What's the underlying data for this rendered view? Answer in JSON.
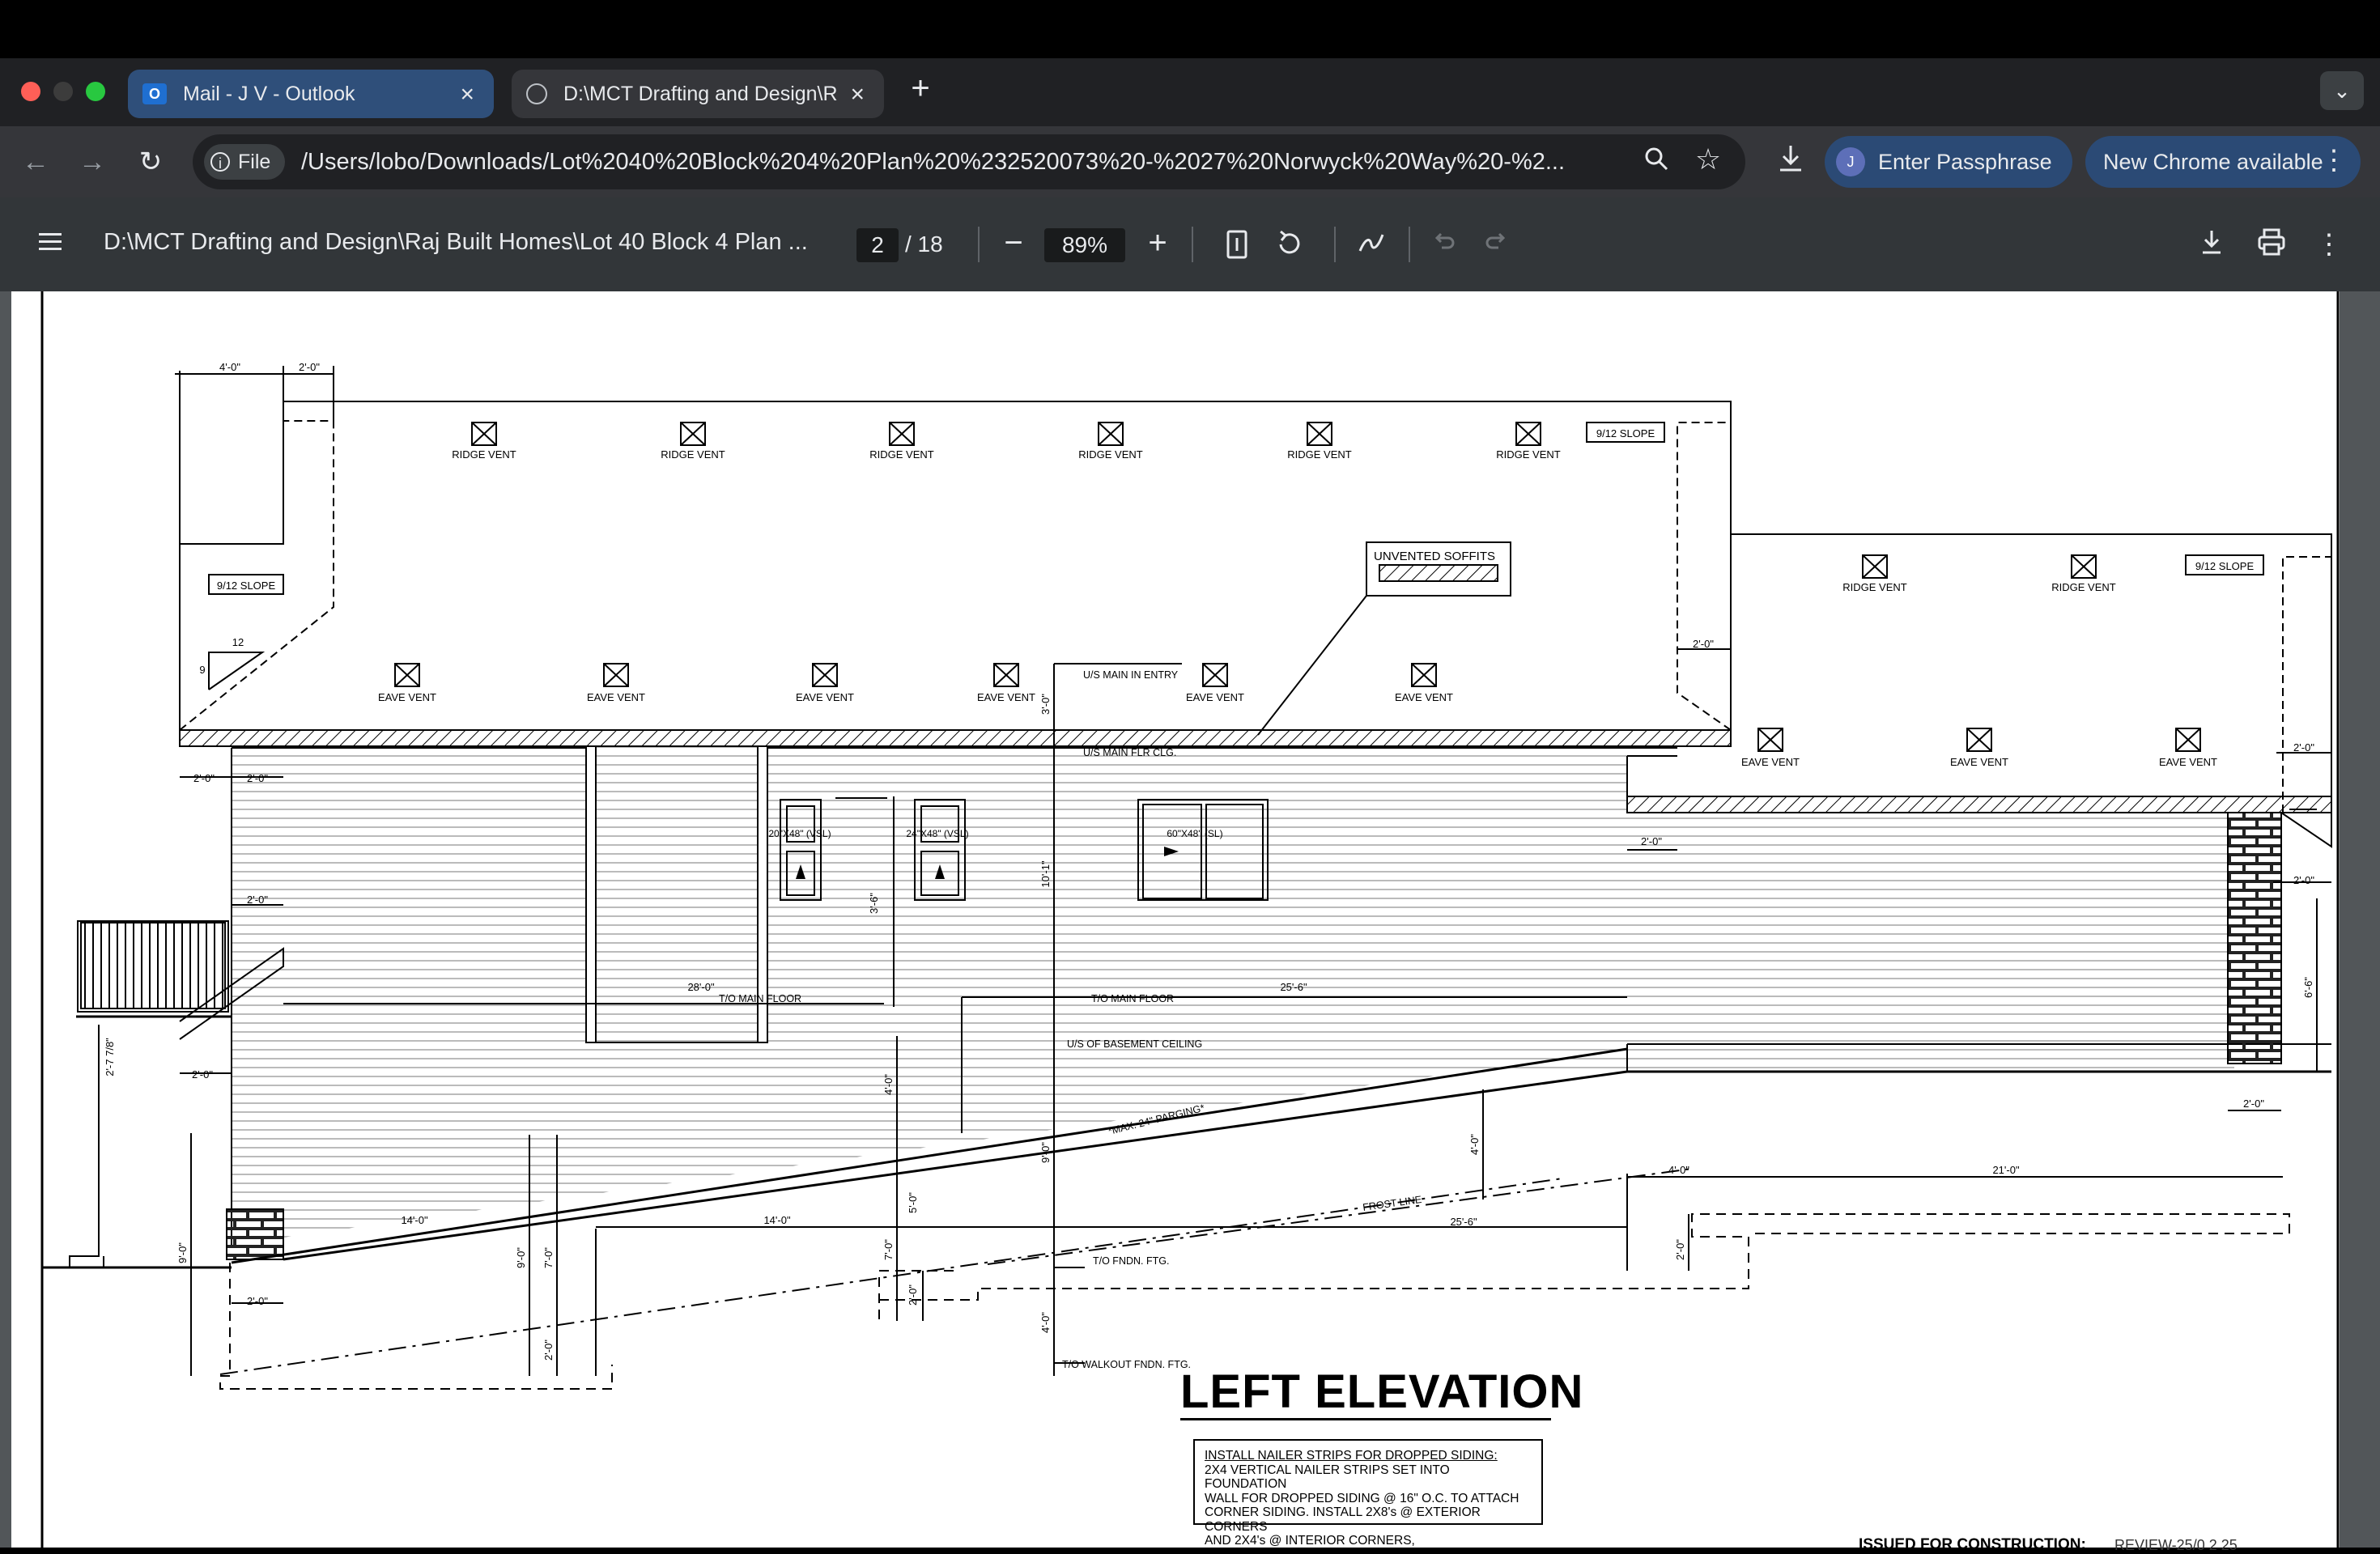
{
  "browser": {
    "tabs": [
      {
        "title": "Mail - J V - Outlook",
        "icon": "outlook-icon",
        "active": false
      },
      {
        "title": "D:\\MCT Drafting and Design\\R",
        "icon": "globe-icon",
        "active": true
      }
    ],
    "new_tab_symbol": "+",
    "url": "/Users/lobo/Downloads/Lot%2040%20Block%204%20Plan%20%232520073%20-%2027%20Norwyck%20Way%20-%2...",
    "security_chip": "File",
    "passphrase_button": "Enter Passphrase",
    "passphrase_avatar": "J",
    "update_button": "New Chrome available"
  },
  "pdf_viewer": {
    "title": "D:\\MCT Drafting and Design\\Raj Built Homes\\Lot 40 Block 4 Plan ...",
    "current_page": "2",
    "total_pages": "/ 18",
    "zoom": "89%"
  },
  "drawing": {
    "title": "LEFT ELEVATION",
    "notes": {
      "heading": "INSTALL NAILER STRIPS FOR DROPPED SIDING:",
      "lines": [
        "2X4 VERTICAL NAILER STRIPS SET INTO FOUNDATION",
        "WALL FOR DROPPED SIDING @ 16\" O.C. TO ATTACH",
        "CORNER SIDING. INSTALL 2X8's @ EXTERIOR CORNERS",
        "AND 2X4's @ INTERIOR CORNERS,"
      ]
    },
    "issued_label": "ISSUED FOR CONSTRUCTION:",
    "review_label": "REVIEW-25/0 2 25",
    "labels": {
      "ridge_vent": "RIDGE VENT",
      "eave_vent": "EAVE VENT",
      "slope": "9/12 SLOPE",
      "unvented_soffits": "UNVENTED SOFFITS",
      "us_main_entry": "U/S MAIN IN ENTRY",
      "us_main_flr_clg": "U/S MAIN FLR CLG.",
      "to_main_floor": "T/O MAIN FLOOR",
      "us_basement_ceiling": "U/S OF BASEMENT CEILING",
      "max_parging": "*MAX. 24\" PARGING*",
      "frost_line": "FROST LINE",
      "to_fndn_ftg": "T/O FNDN. FTG.",
      "to_walkout_fndn_ftg": "T/O WALKOUT FNDN. FTG.",
      "win1": "20\"X48\" (VSL)",
      "win2": "24\"X48\" (VSL)",
      "win3": "60\"X48\" (SL)",
      "pitch_rise": "9",
      "pitch_run": "12"
    },
    "dims": {
      "d4_0": "4'-0\"",
      "d2_0": "2'-0\"",
      "d28_0": "28'-0\"",
      "d25_6": "25'-6\"",
      "d14_0": "14'-0\"",
      "d21_0": "21'-0\"",
      "d9_0": "9'-0\"",
      "d7_0": "7'-0\"",
      "d5_0": "5'-0\"",
      "d6_6": "6'-6\"",
      "d10_1": "10'-1\"",
      "d3_0": "3'-0\"",
      "d3_6": "3'-6\"",
      "d2_7": "2'-7 7/8\""
    }
  }
}
